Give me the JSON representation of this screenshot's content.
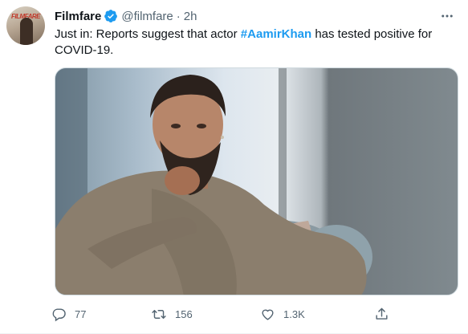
{
  "tweet": {
    "author_name": "Filmfare",
    "author_handle": "@filmfare",
    "separator": "·",
    "time": "2h",
    "verified": true,
    "avatar_icon": "filmfare-cover-avatar",
    "text_prefix": "Just in: Reports suggest that actor ",
    "hashtag": "#AamirKhan",
    "text_suffix": " has tested positive for COVID-19.",
    "media_icon": "photo-of-bearded-man-seated",
    "avatar_masthead": "FILMFARE"
  },
  "actions": {
    "reply_count": "77",
    "retweet_count": "156",
    "like_count": "1.3K",
    "reply_icon": "reply-icon",
    "retweet_icon": "retweet-icon",
    "like_icon": "heart-icon",
    "share_icon": "share-icon"
  },
  "colors": {
    "link": "#1d9bf0",
    "secondary_text": "#536471",
    "primary_text": "#0f1419"
  }
}
